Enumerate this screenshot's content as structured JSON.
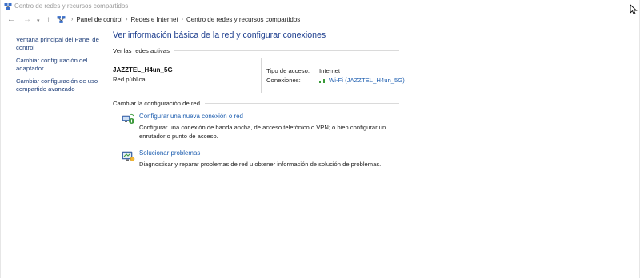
{
  "window": {
    "title": "Centro de redes y recursos compartidos"
  },
  "navigation": {
    "back": "←",
    "forward": "→",
    "dropdown": "▾",
    "up": "↑",
    "separator": "›",
    "breadcrumbs": [
      "Panel de control",
      "Redes e Internet",
      "Centro de redes y recursos compartidos"
    ]
  },
  "sidebar": {
    "links": [
      "Ventana principal del Panel de control",
      "Cambiar configuración del adaptador",
      "Cambiar configuración de uso compartido avanzado"
    ]
  },
  "main": {
    "title": "Ver información básica de la red y configurar conexiones",
    "active_networks_heading": "Ver las redes activas",
    "network": {
      "name": "JAZZTEL_H4un_5G",
      "category": "Red pública",
      "access_type_label": "Tipo de acceso:",
      "access_type_value": "Internet",
      "connections_label": "Conexiones:",
      "connection_link": "Wi-Fi (JAZZTEL_H4un_5G)"
    },
    "change_settings_heading": "Cambiar la configuración de red",
    "tasks": [
      {
        "link": "Configurar una nueva conexión o red",
        "description": "Configurar una conexión de banda ancha, de acceso telefónico o VPN; o bien configurar un enrutador o punto de acceso."
      },
      {
        "link": "Solucionar problemas",
        "description": "Diagnosticar y reparar problemas de red u obtener información de solución de problemas."
      }
    ]
  },
  "colors": {
    "link": "#1f5fb0",
    "title": "#1e3f8f",
    "wifi_signal": "#3a9a3a"
  },
  "icons": {
    "window": "network-sharing-icon",
    "task_1": "new-connection-icon",
    "task_2": "troubleshoot-icon",
    "connection": "wifi-signal-icon"
  }
}
